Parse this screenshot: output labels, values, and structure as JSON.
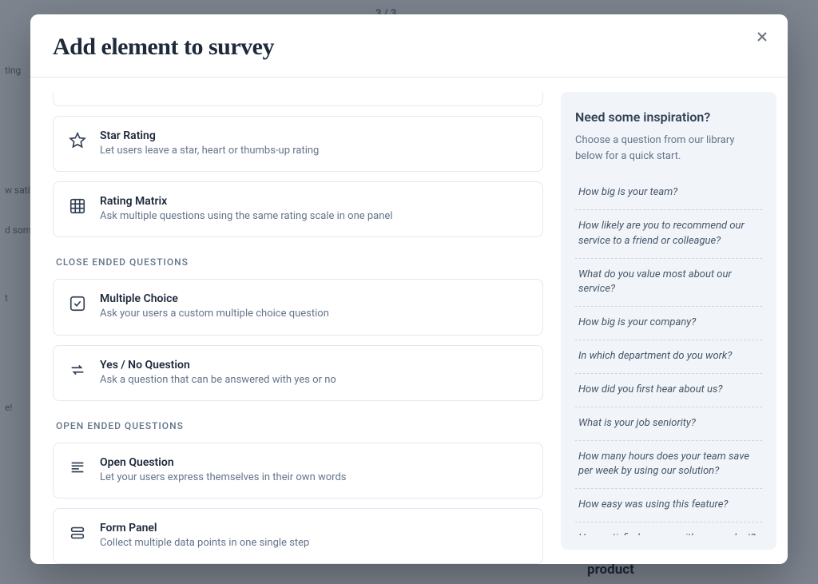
{
  "background": {
    "counter": "3 / 3",
    "left_items": [
      "ting",
      "w sati",
      "d som",
      "t",
      "e!"
    ],
    "bottom": "How satisfied are you with our product"
  },
  "modal": {
    "title": "Add element to survey"
  },
  "sections": {
    "close_ended": "CLOSE ENDED QUESTIONS",
    "open_ended": "OPEN ENDED QUESTIONS"
  },
  "elements": {
    "star_rating": {
      "title": "Star Rating",
      "desc": "Let users leave a star, heart or thumbs-up rating"
    },
    "rating_matrix": {
      "title": "Rating Matrix",
      "desc": "Ask multiple questions using the same rating scale in one panel"
    },
    "multiple_choice": {
      "title": "Multiple Choice",
      "desc": "Ask your users a custom multiple choice question"
    },
    "yes_no": {
      "title": "Yes / No Question",
      "desc": "Ask a question that can be answered with yes or no"
    },
    "open_question": {
      "title": "Open Question",
      "desc": "Let your users express themselves in their own words"
    },
    "form_panel": {
      "title": "Form Panel",
      "desc": "Collect multiple data points in one single step"
    }
  },
  "inspiration": {
    "title": "Need some inspiration?",
    "subtitle": "Choose a question from our library below for a quick start.",
    "items": [
      "How big is your team?",
      "How likely are you to recommend our service to a friend or colleague?",
      "What do you value most about our service?",
      "How big is your company?",
      "In which department do you work?",
      "How did you first hear about us?",
      "What is your job seniority?",
      "How many hours does your team save per week by using our solution?",
      "How easy was using this feature?",
      "How satisfied are you with our product?"
    ]
  }
}
